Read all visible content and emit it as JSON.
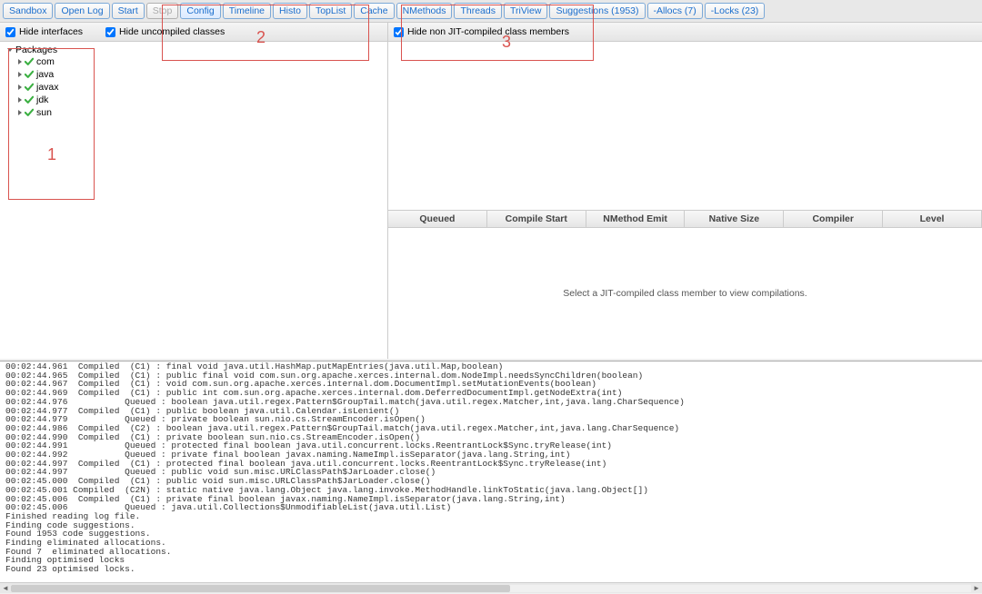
{
  "toolbar": {
    "sandbox": "Sandbox",
    "open_log": "Open Log",
    "start": "Start",
    "stop": "Stop",
    "config": "Config",
    "timeline": "Timeline",
    "histo": "Histo",
    "toplist": "TopList",
    "cache": "Cache",
    "nmethods": "NMethods",
    "threads": "Threads",
    "triview": "TriView",
    "suggestions": "Suggestions (1953)",
    "allocs": "-Allocs (7)",
    "locks": "-Locks (23)"
  },
  "left": {
    "hide_interfaces": "Hide interfaces",
    "hide_uncompiled": "Hide uncompiled classes",
    "packages_label": "Packages",
    "packages": [
      {
        "name": "com"
      },
      {
        "name": "java"
      },
      {
        "name": "javax"
      },
      {
        "name": "jdk"
      },
      {
        "name": "sun"
      }
    ]
  },
  "right": {
    "hide_nonjit": "Hide non JIT-compiled class members",
    "columns": {
      "queued": "Queued",
      "compile_start": "Compile Start",
      "nmethod_emit": "NMethod Emit",
      "native_size": "Native Size",
      "compiler": "Compiler",
      "level": "Level"
    },
    "placeholder": "Select a JIT-compiled class member to view compilations."
  },
  "annotations": {
    "l1": "1",
    "l2": "2",
    "l3": "3"
  },
  "log_lines": [
    "00:02:44.961  Compiled  (C1) : final void java.util.HashMap.putMapEntries(java.util.Map,boolean)",
    "00:02:44.965  Compiled  (C1) : public final void com.sun.org.apache.xerces.internal.dom.NodeImpl.needsSyncChildren(boolean)",
    "00:02:44.967  Compiled  (C1) : void com.sun.org.apache.xerces.internal.dom.DocumentImpl.setMutationEvents(boolean)",
    "00:02:44.969  Compiled  (C1) : public int com.sun.org.apache.xerces.internal.dom.DeferredDocumentImpl.getNodeExtra(int)",
    "00:02:44.976           Queued : boolean java.util.regex.Pattern$GroupTail.match(java.util.regex.Matcher,int,java.lang.CharSequence)",
    "00:02:44.977  Compiled  (C1) : public boolean java.util.Calendar.isLenient()",
    "00:02:44.979           Queued : private boolean sun.nio.cs.StreamEncoder.isOpen()",
    "00:02:44.986  Compiled  (C2) : boolean java.util.regex.Pattern$GroupTail.match(java.util.regex.Matcher,int,java.lang.CharSequence)",
    "00:02:44.990  Compiled  (C1) : private boolean sun.nio.cs.StreamEncoder.isOpen()",
    "00:02:44.991           Queued : protected final boolean java.util.concurrent.locks.ReentrantLock$Sync.tryRelease(int)",
    "00:02:44.992           Queued : private final boolean javax.naming.NameImpl.isSeparator(java.lang.String,int)",
    "00:02:44.997  Compiled  (C1) : protected final boolean java.util.concurrent.locks.ReentrantLock$Sync.tryRelease(int)",
    "00:02:44.997           Queued : public void sun.misc.URLClassPath$JarLoader.close()",
    "00:02:45.000  Compiled  (C1) : public void sun.misc.URLClassPath$JarLoader.close()",
    "00:02:45.001 Compiled  (C2N) : static native java.lang.Object java.lang.invoke.MethodHandle.linkToStatic(java.lang.Object[])",
    "00:02:45.006  Compiled  (C1) : private final boolean javax.naming.NameImpl.isSeparator(java.lang.String,int)",
    "00:02:45.006           Queued : java.util.Collections$UnmodifiableList(java.util.List)",
    "Finished reading log file.",
    "Finding code suggestions.",
    "Found 1953 code suggestions.",
    "Finding eliminated allocations.",
    "Found 7  eliminated allocations.",
    "Finding optimised locks",
    "Found 23 optimised locks."
  ]
}
